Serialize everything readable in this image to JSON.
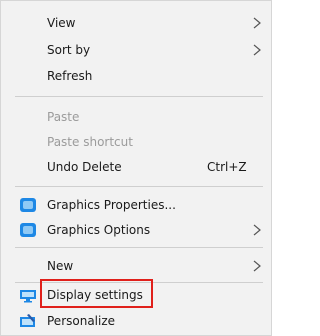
{
  "menu": {
    "items": [
      {
        "label": "View",
        "has_submenu": true,
        "enabled": true
      },
      {
        "label": "Sort by",
        "has_submenu": true,
        "enabled": true
      },
      {
        "label": "Refresh",
        "has_submenu": false,
        "enabled": true
      },
      {
        "label": "Paste",
        "has_submenu": false,
        "enabled": false
      },
      {
        "label": "Paste shortcut",
        "has_submenu": false,
        "enabled": false
      },
      {
        "label": "Undo Delete",
        "shortcut": "Ctrl+Z",
        "enabled": true
      },
      {
        "label": "Graphics Properties...",
        "icon": "graphics-icon",
        "enabled": true
      },
      {
        "label": "Graphics Options",
        "icon": "graphics-icon",
        "has_submenu": true,
        "enabled": true
      },
      {
        "label": "New",
        "has_submenu": true,
        "enabled": true
      },
      {
        "label": "Display settings",
        "icon": "display-icon",
        "enabled": true,
        "highlighted": true
      },
      {
        "label": "Personalize",
        "icon": "personalize-icon",
        "enabled": true
      }
    ]
  },
  "colors": {
    "menu_background": "#f2f2f2",
    "highlight_border": "#e0201b",
    "text": "#1a1a1a",
    "disabled_text": "#9b9b9b",
    "icon_blue": "#1e88e5"
  }
}
